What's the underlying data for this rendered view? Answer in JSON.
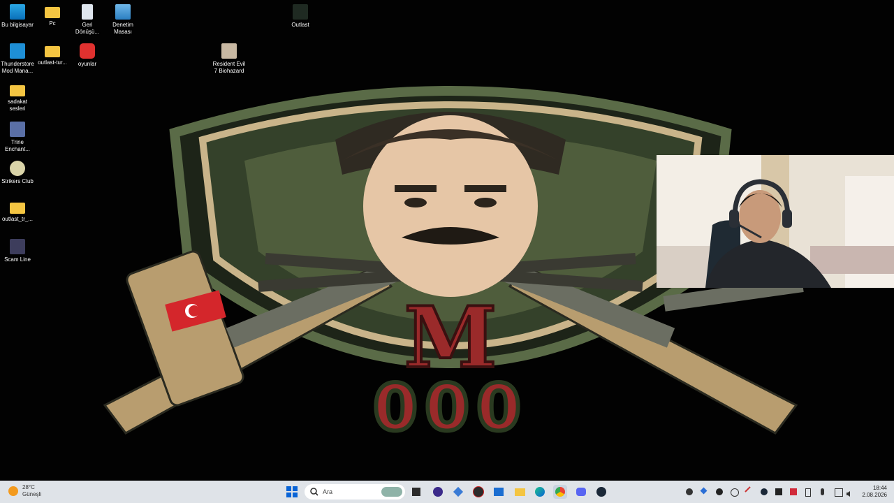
{
  "desktop": {
    "icons": [
      {
        "label": "Bu bilgisayar",
        "icon": "monitor-icon"
      },
      {
        "label": "Pc",
        "icon": "folder-icon"
      },
      {
        "label": "Geri Dönüşü...",
        "icon": "recycle-bin-icon"
      },
      {
        "label": "Denetim Masası",
        "icon": "control-panel-icon"
      },
      {
        "label": "Outlast",
        "icon": "game-shortcut-icon"
      },
      {
        "label": "Thunderstore Mod Mana...",
        "icon": "thunderstore-icon"
      },
      {
        "label": "outlast-tur...",
        "icon": "folder-icon"
      },
      {
        "label": "oyunlar",
        "icon": "power-icon"
      },
      {
        "label": "Resident Evil 7 Biohazard",
        "icon": "game-shortcut-icon"
      },
      {
        "label": "sadakat sesleri",
        "icon": "folder-icon"
      },
      {
        "label": "Trine Enchant...",
        "icon": "game-shortcut-icon"
      },
      {
        "label": "Strikers Club",
        "icon": "shield-icon"
      },
      {
        "label": "outlast_tr_...",
        "icon": "folder-icon"
      },
      {
        "label": "Scam Line",
        "icon": "game-shortcut-icon"
      }
    ],
    "wallpaper": {
      "monogram": "M",
      "number": "000"
    }
  },
  "taskbar": {
    "weather_temp": "28°C",
    "weather_desc": "Güneşli",
    "search_placeholder": "Ara",
    "time": "18:44",
    "date": "2.08.2026"
  },
  "colors": {
    "taskbar_bg": "#dfe3e8",
    "accent": "#0a64d6",
    "wallpaper_green": "#4a5a3a",
    "wallpaper_red": "#9a2a2a"
  }
}
